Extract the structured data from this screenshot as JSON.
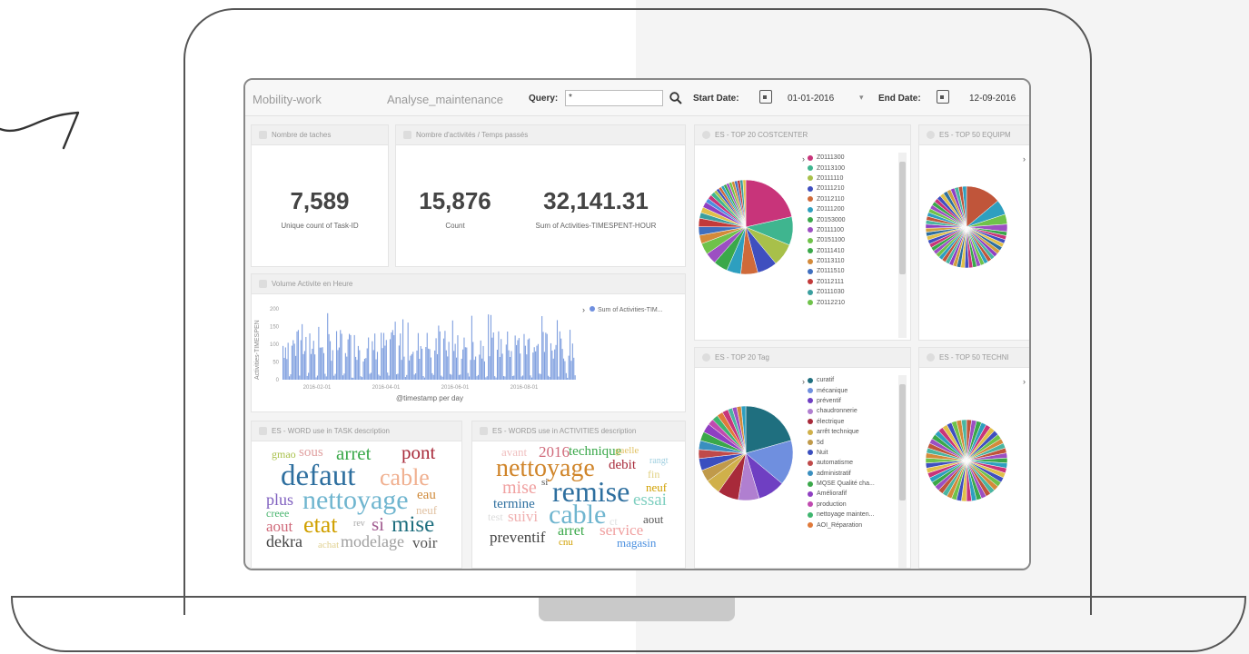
{
  "topbar": {
    "app_name": "Mobility-work",
    "dashboard_name": "Analyse_maintenance",
    "query_label": "Query:",
    "query_value": "*",
    "start_label": "Start Date:",
    "start_value": "01-01-2016",
    "end_label": "End Date:",
    "end_value": "12-09-2016"
  },
  "panels": {
    "tasks": {
      "title": "Nombre de taches",
      "value": "7,589",
      "label": "Unique count of Task-ID"
    },
    "activities": {
      "title": "Nombre d'activités / Temps passés",
      "count_value": "15,876",
      "count_label": "Count",
      "sum_value": "32,141.31",
      "sum_label": "Sum of Activities-TIMESPENT-HOUR"
    },
    "volume": {
      "title": "Volume Activite en Heure",
      "ylabel": "Activities-TIMESPEN",
      "xlabel": "@timestamp per day",
      "legend": "Sum of Activities-TIM...",
      "yticks": [
        "200",
        "150",
        "100",
        "50",
        "0"
      ],
      "xticks": [
        "2016-02-01",
        "2016-04-01",
        "2016-06-01",
        "2016-08-01"
      ]
    },
    "costcenter": {
      "title": "ES - TOP 20 COSTCENTER",
      "legend": [
        {
          "label": "Z0111300",
          "color": "#c8347a"
        },
        {
          "label": "Z0113100",
          "color": "#3fb58f"
        },
        {
          "label": "Z0111110",
          "color": "#a8c04a"
        },
        {
          "label": "Z0111210",
          "color": "#3f4fbf"
        },
        {
          "label": "Z0112110",
          "color": "#cf6a3a"
        },
        {
          "label": "Z0111200",
          "color": "#2e9fbf"
        },
        {
          "label": "Z0153000",
          "color": "#3aa84a"
        },
        {
          "label": "Z0111100",
          "color": "#9c4fc2"
        },
        {
          "label": "Z0151100",
          "color": "#6fc24a"
        },
        {
          "label": "Z0111410",
          "color": "#3aa84a"
        },
        {
          "label": "Z0113110",
          "color": "#d48a3a"
        },
        {
          "label": "Z0111510",
          "color": "#3f6fbf"
        },
        {
          "label": "Z0112111",
          "color": "#c23a3a"
        },
        {
          "label": "Z0111030",
          "color": "#3a9f9f"
        },
        {
          "label": "Z0112210",
          "color": "#6fc24a"
        }
      ]
    },
    "equipment": {
      "title": "ES - TOP 50 EQUIPM"
    },
    "tag": {
      "title": "ES - TOP 20 Tag",
      "legend": [
        {
          "label": "curatif",
          "color": "#1f6f7f"
        },
        {
          "label": "mécanique",
          "color": "#6f8fdf"
        },
        {
          "label": "préventif",
          "color": "#6f3fc2"
        },
        {
          "label": "chaudronnerie",
          "color": "#b07fd0"
        },
        {
          "label": "électrique",
          "color": "#a82a3a"
        },
        {
          "label": "arrêt technique",
          "color": "#d0b04a"
        },
        {
          "label": "5d",
          "color": "#c09a4a"
        },
        {
          "label": "Nuit",
          "color": "#3a4fbf"
        },
        {
          "label": "automatisme",
          "color": "#c04a4a"
        },
        {
          "label": "administratif",
          "color": "#3a8fbf"
        },
        {
          "label": "MQSE Qualité cha...",
          "color": "#3aa84a"
        },
        {
          "label": "Améliorafif",
          "color": "#8f3fc2"
        },
        {
          "label": "production",
          "color": "#c04ab0"
        },
        {
          "label": "nettoyage mainten...",
          "color": "#3fb56f"
        },
        {
          "label": "AOI_Réparation",
          "color": "#e07a3a"
        }
      ]
    },
    "technic": {
      "title": "ES - TOP 50 TECHNI"
    },
    "word_task": {
      "title": "ES - WORD use in TASK description",
      "words": [
        "gmao",
        "sous",
        "arret",
        "pont",
        "defaut",
        "cable",
        "plus",
        "nettoyage",
        "eau",
        "creee",
        "neuf",
        "aout",
        "etat",
        "rev",
        "si",
        "mise",
        "dekra",
        "achat",
        "modelage",
        "voir"
      ]
    },
    "word_activities": {
      "title": "ES - WORDS use in ACTIVITIES description",
      "words": [
        "avant",
        "2016",
        "technique",
        "gaelle",
        "nettoyage",
        "debit",
        "rangt",
        "fin",
        "mise",
        "si",
        "remise",
        "neuf",
        "termine",
        "essai",
        "test",
        "suivi",
        "cable",
        "ct",
        "aout",
        "preventif",
        "arret",
        "service",
        "cnu",
        "magasin"
      ]
    }
  }
}
